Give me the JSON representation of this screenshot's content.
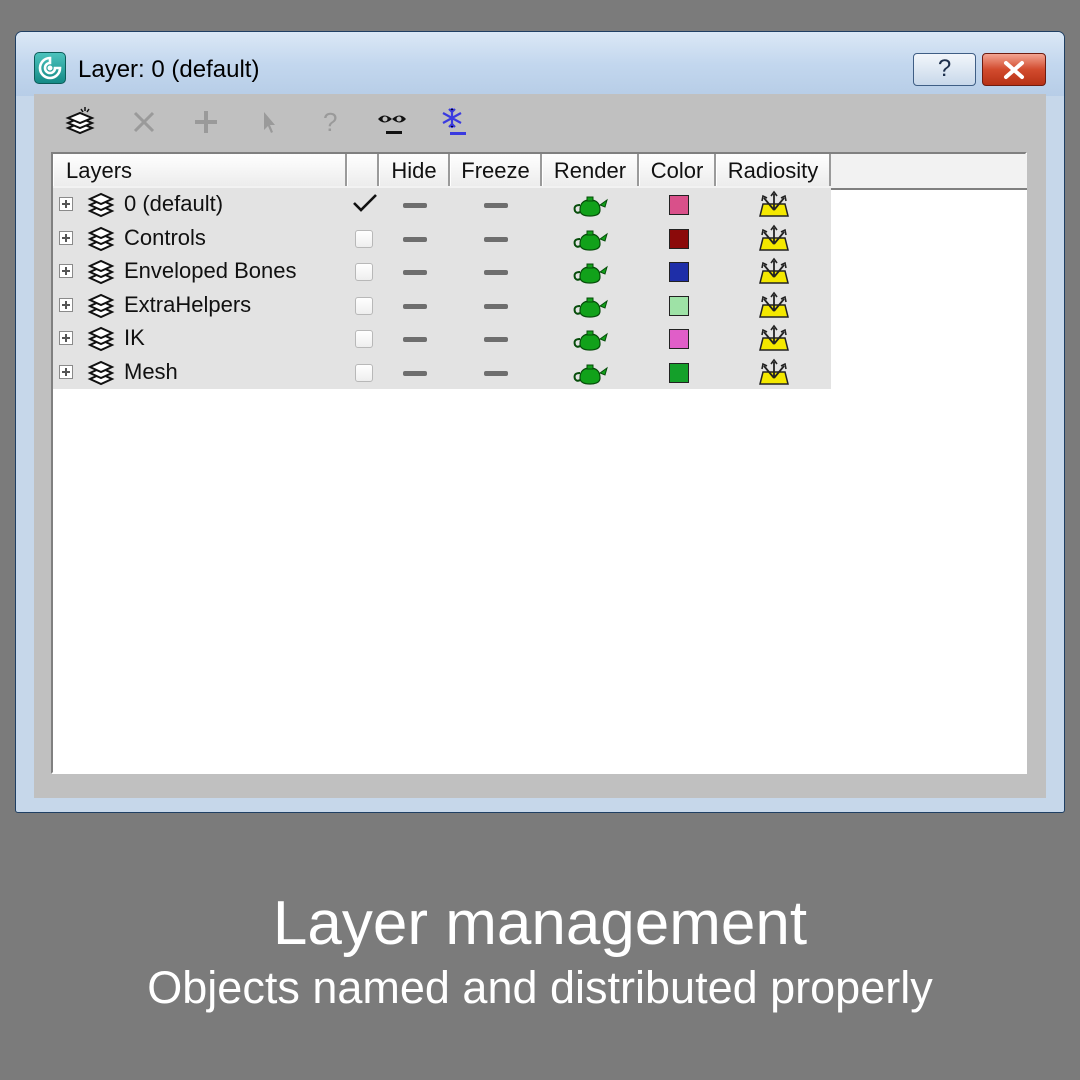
{
  "window": {
    "title": "Layer: 0 (default)",
    "help_label": "?",
    "accent_title_bar": "#c3d7ee",
    "close_button_color": "#d24b2e"
  },
  "toolbar": {
    "items": [
      {
        "icon": "new-layer-icon",
        "enabled": true
      },
      {
        "icon": "delete-layer-icon",
        "enabled": false
      },
      {
        "icon": "add-to-layer-icon",
        "enabled": false
      },
      {
        "icon": "select-objects-icon",
        "enabled": false
      },
      {
        "icon": "highlight-selected-icon",
        "enabled": false
      },
      {
        "icon": "hide-all-icon",
        "enabled": true
      },
      {
        "icon": "freeze-all-icon",
        "enabled": true
      }
    ]
  },
  "columns": [
    "Layers",
    "",
    "Hide",
    "Freeze",
    "Render",
    "Color",
    "Radiosity"
  ],
  "layers": [
    {
      "name": "0 (default)",
      "active": true,
      "color": "#d9508a"
    },
    {
      "name": "Controls",
      "active": false,
      "color": "#8b0a0a"
    },
    {
      "name": "Enveloped Bones",
      "active": false,
      "color": "#1e2ea8"
    },
    {
      "name": "ExtraHelpers",
      "active": false,
      "color": "#9ee2a6"
    },
    {
      "name": "IK",
      "active": false,
      "color": "#e05ec8"
    },
    {
      "name": "Mesh",
      "active": false,
      "color": "#14a02a"
    }
  ],
  "caption": {
    "title": "Layer management",
    "subtitle": "Objects named and distributed properly"
  }
}
